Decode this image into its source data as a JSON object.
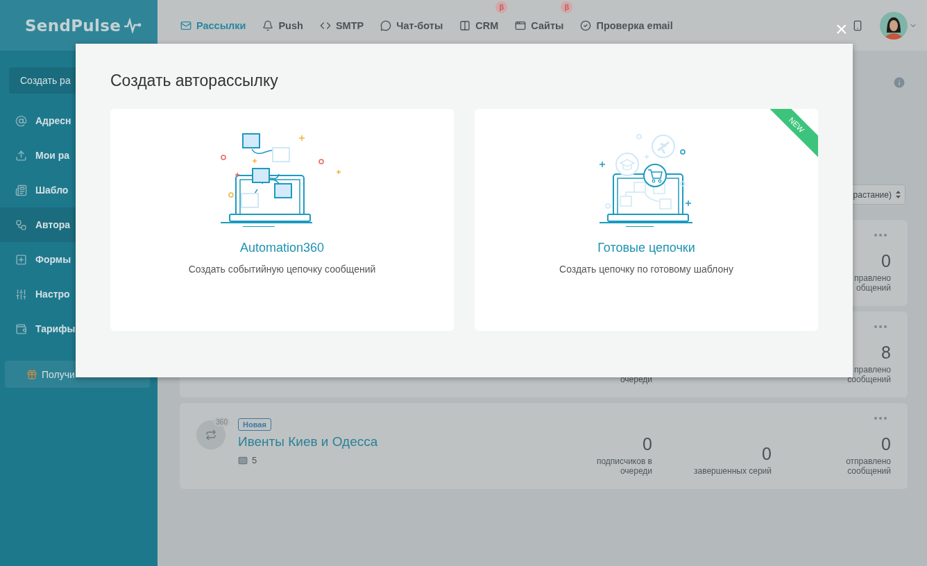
{
  "logo": {
    "text": "SendPulse"
  },
  "nav": [
    {
      "label": "Рассылки",
      "selected": true
    },
    {
      "label": "Push",
      "selected": false
    },
    {
      "label": "SMTP",
      "selected": false
    },
    {
      "label": "Чат-боты",
      "selected": false
    },
    {
      "label": "CRM",
      "selected": false,
      "badge": "β"
    },
    {
      "label": "Сайты",
      "selected": false,
      "badge": "β"
    },
    {
      "label": "Проверка email",
      "selected": false
    }
  ],
  "sidebar": {
    "create_button": "Создать ра",
    "items": [
      {
        "label": "Адресн",
        "selected": false
      },
      {
        "label": "Мои ра",
        "selected": false
      },
      {
        "label": "Шабло",
        "selected": false
      },
      {
        "label": "Автора",
        "selected": true
      },
      {
        "label": "Формы",
        "selected": false
      },
      {
        "label": "Настро",
        "selected": false
      },
      {
        "label": "Тарифы",
        "selected": false
      }
    ],
    "bonus_button": "Получи"
  },
  "sort_select": {
    "value": "растание)"
  },
  "campaigns": [
    {
      "sent": {
        "value": "0",
        "label": "правлено\nобщений"
      }
    },
    {
      "queued": {
        "label": "очереди"
      },
      "sent": {
        "value": "8",
        "label": "правлено\nсообщений"
      }
    },
    {
      "icon_badge": "360",
      "badge": "Новая",
      "title": "Ивенты Киев и Одесса",
      "count": "5",
      "queued": {
        "value": "0",
        "label": "подписчиков в\nочереди"
      },
      "completed": {
        "value": "0",
        "label": "завершенных серий"
      },
      "sent": {
        "value": "0",
        "label": "отправлено\nсообщений"
      }
    }
  ],
  "modal": {
    "title": "Создать авторассылку",
    "close": "×",
    "options": [
      {
        "kind": "automation",
        "title": "Automation360",
        "subtitle": "Создать событийную цепочку сообщений",
        "new": false
      },
      {
        "kind": "chains",
        "title": "Готовые цепочки",
        "subtitle": "Создать цепочку по готовому шаблону",
        "new": true,
        "ribbon": "NEW"
      }
    ]
  }
}
